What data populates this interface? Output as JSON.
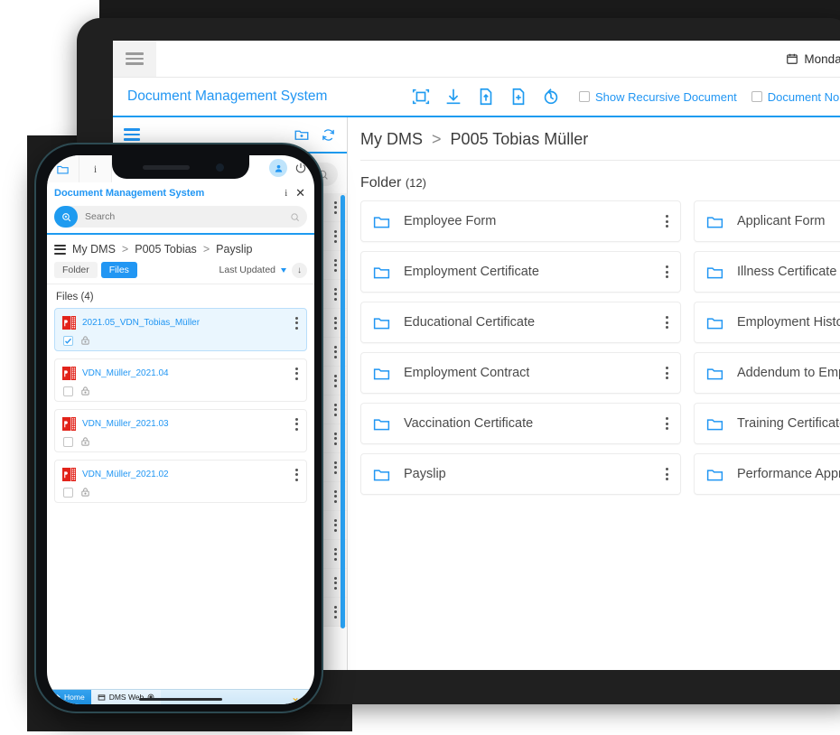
{
  "desktop": {
    "statusbar": {
      "date": "Monday, September",
      "calendar_icon": "calendar-icon",
      "menu_icon": "hamburger-menu-icon"
    },
    "toolbar": {
      "app_title": "Document Management System",
      "icons": [
        {
          "name": "scan-document-icon",
          "label": "Scan"
        },
        {
          "name": "download-icon",
          "label": "Download"
        },
        {
          "name": "upload-file-icon",
          "label": "Upload"
        },
        {
          "name": "add-file-icon",
          "label": "Add File"
        },
        {
          "name": "version-history-icon",
          "label": "History"
        }
      ],
      "checkboxes": [
        {
          "label": "Show Recursive Document",
          "checked": false
        },
        {
          "label": "Document No",
          "checked": false
        }
      ],
      "search_button_icon": "search-zoom-icon",
      "accent_color": "#1e9bf0"
    },
    "sidebar": {
      "menu_icon": "hamburger-menu-icon",
      "add_folder_icon": "add-folder-icon",
      "refresh_icon": "refresh-icon",
      "search_icon": "search-icon",
      "tree_rows": 15,
      "scrollbar_color": "#29a3f5"
    },
    "content": {
      "breadcrumb": {
        "root": "My DMS",
        "separator": ">",
        "current": "P005 Tobias Müller"
      },
      "folder_heading": "Folder",
      "folder_count": "(12)",
      "folders": [
        {
          "name": "Employee Form"
        },
        {
          "name": "Applicant Form"
        },
        {
          "name": "Employment Certificate"
        },
        {
          "name": "Illness Certificate"
        },
        {
          "name": "Educational Certificate"
        },
        {
          "name": "Employment History"
        },
        {
          "name": "Employment Contract"
        },
        {
          "name": "Addendum to Employ"
        },
        {
          "name": "Vaccination Certificate"
        },
        {
          "name": "Training Certificate"
        },
        {
          "name": "Payslip"
        },
        {
          "name": "Performance Apprais"
        }
      ]
    }
  },
  "phone": {
    "tabs": [
      {
        "name": "folder-tab",
        "icon": "folder-icon"
      },
      {
        "name": "info-tab",
        "icon": "info-icon",
        "label": "i"
      }
    ],
    "top_icons": [
      {
        "name": "avatar",
        "icon": "user-icon"
      },
      {
        "name": "power-button",
        "icon": "power-icon"
      }
    ],
    "title": "Document Management System",
    "title_icons": [
      {
        "name": "info-icon",
        "label": "i"
      },
      {
        "name": "close-icon",
        "label": "✕"
      }
    ],
    "search": {
      "placeholder": "Search",
      "value": "",
      "button_icon": "search-zoom-icon",
      "trailing_icon": "search-icon"
    },
    "breadcrumb": {
      "menu_icon": "hamburger-menu-icon",
      "items": [
        "My DMS",
        "P005 Tobias",
        "Payslip"
      ],
      "separator": ">"
    },
    "toggle": {
      "folder_label": "Folder",
      "files_label": "Files",
      "active": "Files"
    },
    "sort": {
      "label": "Last Updated",
      "direction_icon": "arrow-down-icon"
    },
    "files_heading": "Files",
    "files_count": "(4)",
    "files": [
      {
        "name": "2021.05_VDN_Tobias_Müller",
        "selected": true,
        "locked": true
      },
      {
        "name": "VDN_Müller_2021.04",
        "selected": false,
        "locked": true
      },
      {
        "name": "VDN_Müller_2021.03",
        "selected": false,
        "locked": true
      },
      {
        "name": "VDN_Müller_2021.02",
        "selected": false,
        "locked": true
      }
    ],
    "taskbar": {
      "home_label": "Home",
      "home_icon": "home-icon",
      "dms_label": "DMS Web",
      "dms_icon": "window-icon",
      "dms_status_icon": "record-circle-icon",
      "right_icon": "chevron-down-icon"
    }
  }
}
